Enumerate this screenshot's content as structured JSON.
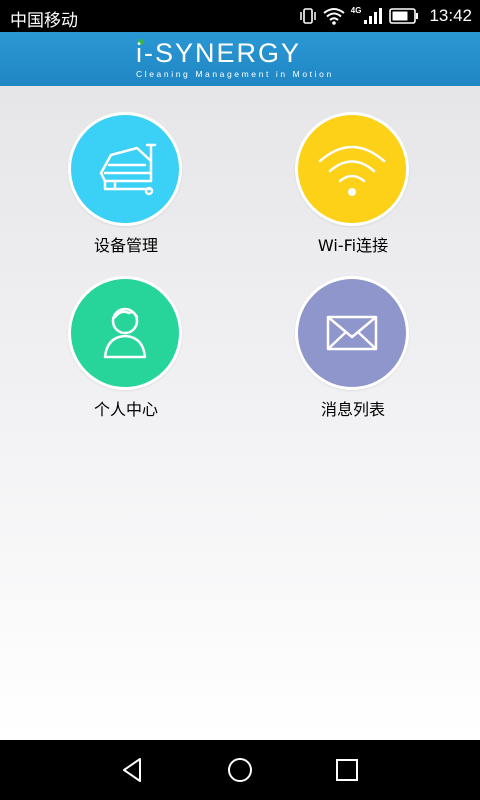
{
  "status_bar": {
    "carrier": "中国移动",
    "network": "4G",
    "time": "13:42"
  },
  "header": {
    "logo_title": "i-SYNERGY",
    "logo_tagline": "Cleaning Management in Motion"
  },
  "tiles": [
    {
      "label": "设备管理",
      "icon": "floor-scrubber-icon",
      "color": "#3bd0f5"
    },
    {
      "label": "Wi-Fi连接",
      "icon": "wifi-icon",
      "color": "#fcd117"
    },
    {
      "label": "个人中心",
      "icon": "user-icon",
      "color": "#27d49a"
    },
    {
      "label": "消息列表",
      "icon": "mail-icon",
      "color": "#8f96cc"
    }
  ],
  "nav_bar": {
    "icons": [
      "back-icon",
      "home-icon",
      "recents-icon"
    ]
  }
}
